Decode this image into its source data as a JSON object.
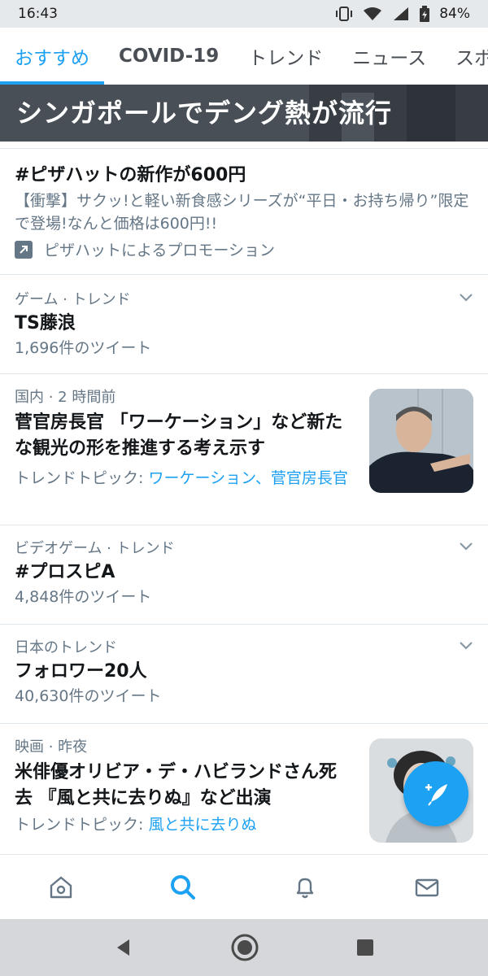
{
  "status_bar": {
    "time": "16:43",
    "battery": "84%"
  },
  "tabs": [
    {
      "label": "おすすめ",
      "active": true
    },
    {
      "label": "COVID-19"
    },
    {
      "label": "トレンド"
    },
    {
      "label": "ニュース"
    },
    {
      "label": "スポーツ"
    }
  ],
  "hero": {
    "title": "シンガポールでデング熱が流行"
  },
  "promo": {
    "title": "#ピザハットの新作が600円",
    "description": "【衝撃】サクッ!と軽い新食感シリーズが“平日・お持ち帰り”限定で登場!なんと価格は600円!!",
    "promoted_by": "ピザハットによるプロモーション"
  },
  "trends": [
    {
      "meta": "ゲーム · トレンド",
      "name": "TS藤浪",
      "count": "1,696件のツイート"
    },
    {
      "meta": "ビデオゲーム · トレンド",
      "name": "#プロスピA",
      "count": "4,848件のツイート"
    },
    {
      "meta": "日本のトレンド",
      "name": "フォロワー20人",
      "count": "40,630件のツイート"
    }
  ],
  "news": [
    {
      "meta": "国内 · 2 時間前",
      "title": "菅官房長官 「ワーケーション」など新たな観光の形を推進する考え示す",
      "topics_label": "トレンドトピック: ",
      "topics_links": "ワーケーション、菅官房長官"
    },
    {
      "meta": "映画 · 昨夜",
      "title": "米俳優オリビア・デ・ハビランドさん死去 『風と共に去りぬ』など出演",
      "topics_label": "トレンドトピック: ",
      "topics_links": "風と共に去りぬ"
    }
  ],
  "icons": {
    "bottom_nav": [
      "home-icon",
      "search-icon",
      "notifications-icon",
      "messages-icon"
    ],
    "fab": "compose-tweet-icon"
  },
  "colors": {
    "accent": "#1da1f2",
    "secondary_text": "#657786",
    "divider": "#e1e8ed"
  }
}
